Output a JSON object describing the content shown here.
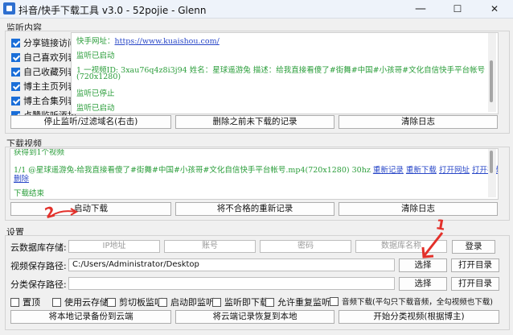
{
  "window": {
    "title": "抖音/快手下载工具 v3.0 - 52pojie - Glenn",
    "minimize": "—",
    "maximize": "☐",
    "close": "✕"
  },
  "monitor": {
    "group_title": "监听内容",
    "checkboxes": [
      {
        "label": "分享链接访问",
        "checked": true
      },
      {
        "label": "自己喜欢列表",
        "checked": true
      },
      {
        "label": "自己收藏列表",
        "checked": true
      },
      {
        "label": "博主主页列表",
        "checked": true
      },
      {
        "label": "博主合集列表",
        "checked": true
      },
      {
        "label": "点赞监听添加",
        "checked": true
      }
    ],
    "log": {
      "line1_label": "快手网址：",
      "line1_url": "https://www.kuaishou.com/",
      "line2": "监听已启动",
      "line3": "1 一视频ID: 3xau76q4z8i3j94 姓名：星球遥游兔 描述：给我直接看傻了#街舞#中国#小孩哥#文化自信快手平台帐号",
      "line4": "(720x1280)",
      "line5": "监听已停止",
      "line6": "监听已启动"
    },
    "buttons": {
      "stop": "停止监听/过滤域名(右击)",
      "delete": "删除之前未下载的记录",
      "clear": "清除日志"
    }
  },
  "download": {
    "group_title": "下载视频",
    "log": {
      "line1": "获得到1个视频",
      "line2_text": "1/1 @星球遥游兔-给我直接看傻了#街舞#中国#小孩哥#文化自信快手平台帐号.mp4(720x1280) 30hz",
      "link_redownload": "重新记录",
      "link_new": "重新下载",
      "link_openurl": "打开网址",
      "link_openvideo": "打开视频",
      "link_delete": "删除",
      "line4": "下载结束"
    },
    "buttons": {
      "start": "启动下载",
      "redownload": "将不合格的重新记录",
      "clear": "清除日志"
    }
  },
  "settings": {
    "group_title": "设置",
    "cloud_label": "云数据库存储:",
    "ip_placeholder": "IP地址",
    "account_placeholder": "账号",
    "password_placeholder": "密码",
    "dbname_placeholder": "数据库名称",
    "login_button": "登录",
    "video_path_label": "视频保存路径:",
    "video_path_value": "C:/Users/Administrator/Desktop",
    "choose_button": "选择",
    "open_dir_button": "打开目录",
    "class_path_label": "分类保存路径:",
    "class_path_value": "",
    "choose_button2": "选择",
    "open_dir_button2": "打开目录",
    "options": [
      {
        "label": "置顶",
        "checked": false
      },
      {
        "label": "使用云存储",
        "checked": false
      },
      {
        "label": "剪切板监听",
        "checked": false
      },
      {
        "label": "启动即监听",
        "checked": false
      },
      {
        "label": "监听即下载",
        "checked": false
      },
      {
        "label": "允许重复监听",
        "checked": false
      },
      {
        "label": "音频下载(平勾只下载音频，全勾视频也下载)",
        "checked": false
      }
    ],
    "buttons": {
      "backup": "将本地记录备份到云端",
      "restore": "将云端记录恢复到本地",
      "classify": "开始分类视频(根据博主)"
    }
  },
  "annotations": {
    "mark1": "1",
    "mark2": "2",
    "color": "#e3302a"
  }
}
